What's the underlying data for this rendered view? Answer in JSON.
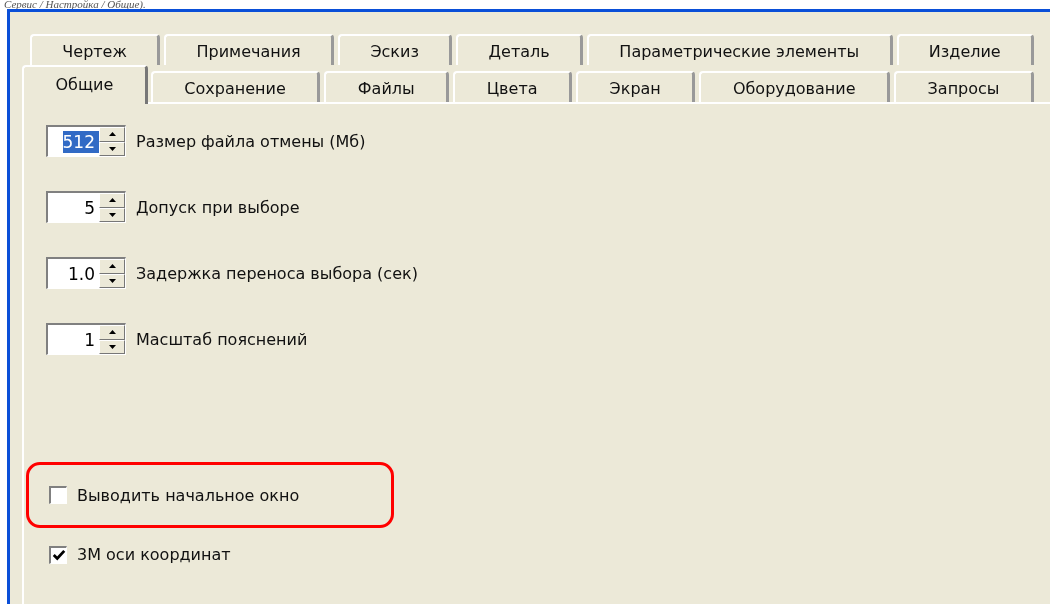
{
  "caption": "Сервис / Настройка / Общие).",
  "tab_rows": [
    {
      "tabs": [
        {
          "label": "Чертеж",
          "selected": false
        },
        {
          "label": "Примечания",
          "selected": false
        },
        {
          "label": "Эскиз",
          "selected": false
        },
        {
          "label": "Деталь",
          "selected": false
        },
        {
          "label": "Параметрические элементы",
          "selected": false
        },
        {
          "label": "Изделие",
          "selected": false
        }
      ]
    },
    {
      "tabs": [
        {
          "label": "Общие",
          "selected": true
        },
        {
          "label": "Сохранение",
          "selected": false
        },
        {
          "label": "Файлы",
          "selected": false
        },
        {
          "label": "Цвета",
          "selected": false
        },
        {
          "label": "Экран",
          "selected": false
        },
        {
          "label": "Оборудование",
          "selected": false
        },
        {
          "label": "Запросы",
          "selected": false
        }
      ]
    }
  ],
  "spinners": [
    {
      "value": "512",
      "label": "Размер файла отмены (Мб)",
      "value_selected": true
    },
    {
      "value": "5",
      "label": "Допуск при выборе",
      "value_selected": false
    },
    {
      "value": "1.0",
      "label": "Задержка переноса выбора (сек)",
      "value_selected": false
    },
    {
      "value": "1",
      "label": "Масштаб пояснений",
      "value_selected": false
    }
  ],
  "checkboxes": [
    {
      "label": "Выводить начальное окно",
      "checked": false,
      "highlighted": true
    },
    {
      "label": "3М оси координат",
      "checked": true,
      "highlighted": false
    }
  ]
}
